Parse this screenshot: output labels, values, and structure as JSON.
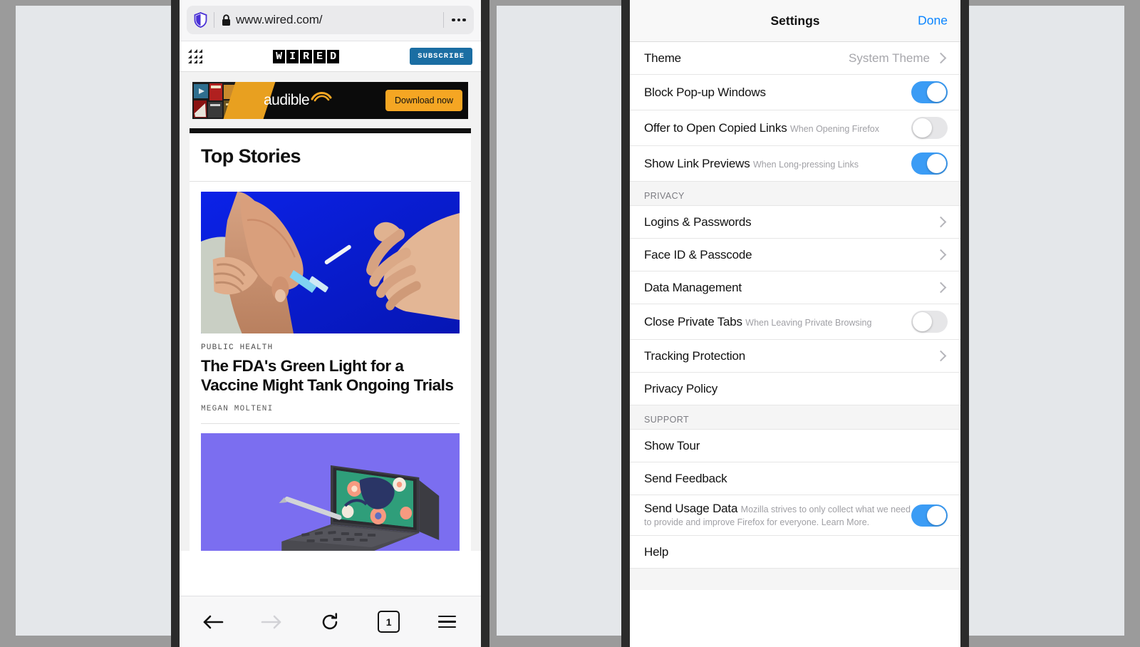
{
  "browser": {
    "urlbar": {
      "shield_icon": "shield-icon",
      "lock_icon": "lock-icon",
      "url": "www.wired.com/",
      "menu_icon": "ellipsis-icon"
    },
    "site_header": {
      "grid_icon": "grid-menu-icon",
      "logo": "WIRED",
      "logo_letters": [
        "W",
        "I",
        "R",
        "E",
        "D"
      ],
      "subscribe_label": "SUBSCRIBE"
    },
    "ad": {
      "brand": "audible",
      "cta_label": "Download now"
    },
    "section_title": "Top Stories",
    "articles": [
      {
        "kicker": "PUBLIC HEALTH",
        "headline": "The FDA's Green Light for a Vaccine Might Tank Ongoing Trials",
        "byline": "MEGAN MOLTENI",
        "image_alt": "vaccine-injection-photo"
      },
      {
        "image_alt": "tablet-with-keyboard-photo"
      }
    ],
    "toolbar": {
      "back_label": "Back",
      "forward_label": "Forward",
      "reload_label": "Reload",
      "tab_count": "1",
      "menu_label": "Menu"
    }
  },
  "settings": {
    "title": "Settings",
    "done_label": "Done",
    "general_rows": [
      {
        "label": "Theme",
        "value": "System Theme",
        "accessory": "chevron"
      },
      {
        "label": "Block Pop-up Windows",
        "accessory": "toggle",
        "toggle": "on"
      },
      {
        "label": "Offer to Open Copied Links",
        "sub": "When Opening Firefox",
        "accessory": "toggle",
        "toggle": "off"
      },
      {
        "label": "Show Link Previews",
        "sub": "When Long-pressing Links",
        "accessory": "toggle",
        "toggle": "on"
      }
    ],
    "privacy_header": "PRIVACY",
    "privacy_rows": [
      {
        "label": "Logins & Passwords",
        "accessory": "chevron"
      },
      {
        "label": "Face ID & Passcode",
        "accessory": "chevron"
      },
      {
        "label": "Data Management",
        "accessory": "chevron"
      },
      {
        "label": "Close Private Tabs",
        "sub": "When Leaving Private Browsing",
        "accessory": "toggle",
        "toggle": "off"
      },
      {
        "label": "Tracking Protection",
        "accessory": "chevron"
      },
      {
        "label": "Privacy Policy",
        "accessory": "none"
      }
    ],
    "support_header": "SUPPORT",
    "support_rows": [
      {
        "label": "Show Tour",
        "accessory": "none"
      },
      {
        "label": "Send Feedback",
        "accessory": "none"
      },
      {
        "label": "Send Usage Data",
        "sub": "Mozilla strives to only collect what we need to provide and improve Firefox for everyone. Learn More.",
        "accessory": "toggle",
        "toggle": "on"
      },
      {
        "label": "Help",
        "accessory": "none"
      }
    ]
  },
  "colors": {
    "accent_blue": "#0a84ff",
    "toggle_on": "#3b9cf5",
    "toggle_off": "#e6e6e8",
    "subscribe_blue": "#1b6ea3",
    "page_bg": "#e4e7ea",
    "bezel": "#2b2b2b"
  }
}
